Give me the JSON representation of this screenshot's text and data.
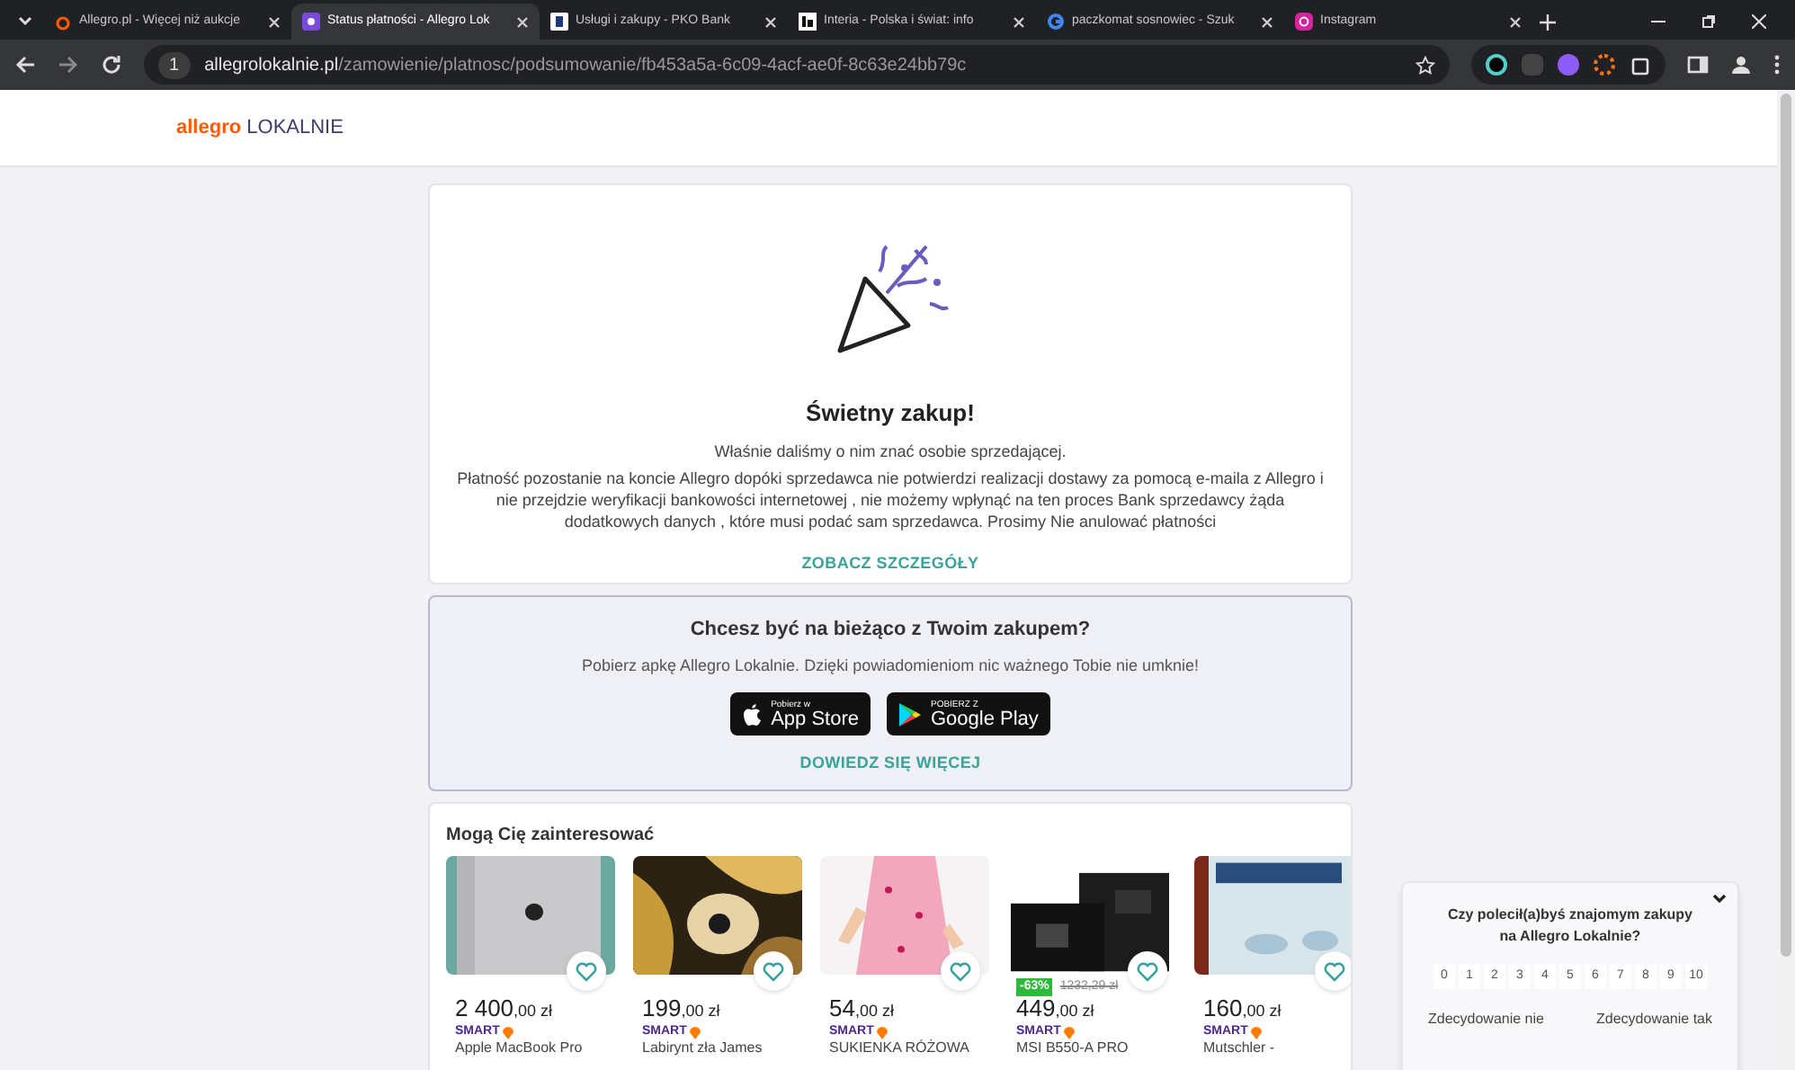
{
  "browser": {
    "tabs": [
      {
        "title": "Allegro.pl - Więcej niż aukcje",
        "selected": false
      },
      {
        "title": "Status płatności - Allegro Lok",
        "selected": true
      },
      {
        "title": "Usługi i zakupy - PKO Bank",
        "selected": false
      },
      {
        "title": "Interia - Polska i świat: info",
        "selected": false
      },
      {
        "title": "paczkomat sosnowiec - Szuk",
        "selected": false
      },
      {
        "title": "Instagram",
        "selected": false
      }
    ],
    "tab_count": "1",
    "url_host": "allegrolokalnie.pl",
    "url_path": "/zamowienie/platnosc/podsumowanie/fb453a5a-6c09-4acf-ae0f-8c63e24bb79c"
  },
  "header": {
    "logo_brand": "allegro",
    "logo_suffix": "LOKALNIE"
  },
  "success": {
    "title": "Świetny zakup!",
    "subtitle": "Właśnie daliśmy o nim znać osobie sprzedającej.",
    "message": "Płatność pozostanie na koncie Allegro dopóki sprzedawca nie potwierdzi realizacji dostawy za pomocą e-maila z Allegro i nie przejdzie weryfikacji bankowości internetowej , nie możemy wpłynąć na ten proces Bank sprzedawcy żąda dodatkowych danych , które musi podać sam sprzedawca. Prosimy Nie anulować płatności",
    "link": "ZOBACZ SZCZEGÓŁY"
  },
  "app_promo": {
    "title": "Chcesz być na bieżąco z Twoim zakupem?",
    "text": "Pobierz apkę Allegro Lokalnie. Dzięki powiadomieniom nic ważnego Tobie nie umknie!",
    "stores": [
      {
        "kind": "apple",
        "small": "Pobierz w",
        "big": "App Store"
      },
      {
        "kind": "google",
        "small": "POBIERZ Z",
        "big": "Google Play"
      }
    ],
    "link": "DOWIEDZ SIĘ WIĘCEJ"
  },
  "recommendations": {
    "title": "Mogą Cię zainteresować",
    "items": [
      {
        "kind": "picture",
        "price_main": "2 400",
        "price_rest": ",00 zł",
        "badge": "SMART",
        "name": "Apple MacBook Pro"
      },
      {
        "kind": "picture",
        "price_main": "199",
        "price_rest": ",00 zł",
        "badge": "SMART",
        "name": "Labirynt zła James"
      },
      {
        "kind": "picture",
        "price_main": "54",
        "price_rest": ",00 zł",
        "badge": "SMART",
        "name": "SUKIENKA RÓŻOWA"
      },
      {
        "kind": "picture",
        "discount": "-63%",
        "old_price": "1232,29 zł",
        "price_main": "449",
        "price_rest": ",00 zł",
        "badge": "SMART",
        "name": "MSI B550-A PRO"
      },
      {
        "kind": "picture",
        "price_main": "160",
        "price_rest": ",00 zł",
        "badge": "SMART",
        "name": "Mutschler -"
      }
    ]
  },
  "survey": {
    "question": "Czy polecił(a)byś znajomym zakupy na Allegro Lokalnie?",
    "scores": [
      "0",
      "1",
      "2",
      "3",
      "4",
      "5",
      "6",
      "7",
      "8",
      "9",
      "10"
    ],
    "low_label": "Zdecydowanie nie",
    "high_label": "Zdecydowanie tak"
  }
}
